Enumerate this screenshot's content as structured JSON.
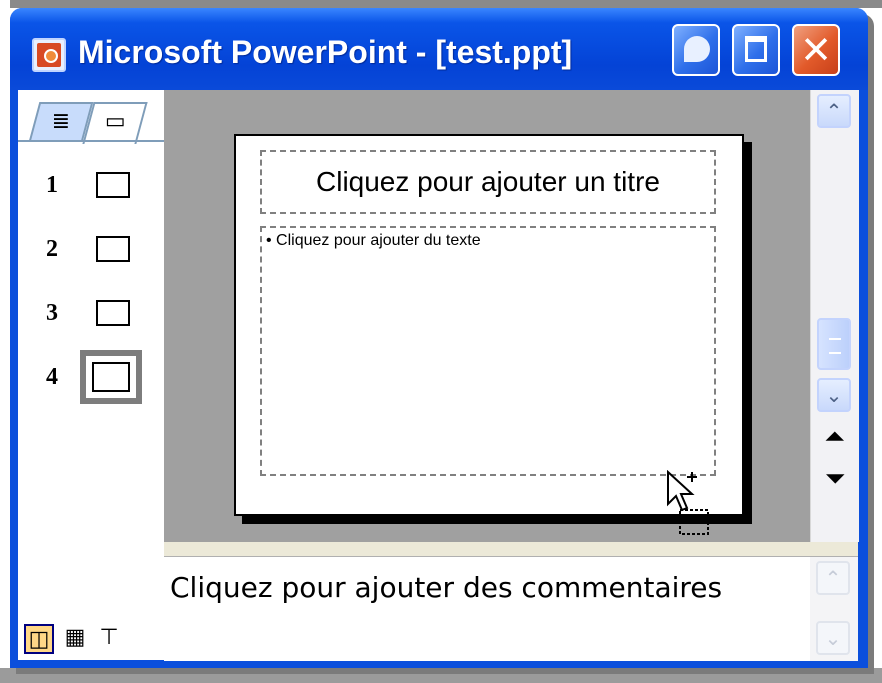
{
  "window": {
    "title": "Microsoft PowerPoint - [test.ppt]",
    "controls": {
      "minimize": "minimize",
      "maximize": "maximize",
      "close": "✕"
    }
  },
  "left_panel": {
    "tabs": [
      {
        "name": "outline",
        "icon": "outline-icon",
        "glyph": "≣"
      },
      {
        "name": "slides",
        "icon": "slides-icon",
        "glyph": "▭"
      }
    ],
    "slides": [
      {
        "number": "1",
        "selected": false
      },
      {
        "number": "2",
        "selected": false
      },
      {
        "number": "3",
        "selected": false
      },
      {
        "number": "4",
        "selected": true
      }
    ],
    "view_buttons": [
      {
        "name": "normal-view",
        "glyph": "◫",
        "active": true
      },
      {
        "name": "slide-sorter-view",
        "glyph": "▦",
        "active": false
      },
      {
        "name": "slide-show-view",
        "glyph": "⊤",
        "active": false
      }
    ]
  },
  "slide": {
    "title_placeholder": "Cliquez pour ajouter un titre",
    "body_placeholder": "• Cliquez pour ajouter du texte"
  },
  "scrollbar": {
    "up": "⌃",
    "down": "⌄",
    "prev_slide": "⏶",
    "next_slide": "⏷"
  },
  "notes": {
    "placeholder": "Cliquez pour ajouter des commentaires"
  },
  "colors": {
    "titlebar": "#0443d6",
    "close_button": "#e25a2a",
    "workspace": "#a0a0a0",
    "selected_view": "#ffd787"
  }
}
